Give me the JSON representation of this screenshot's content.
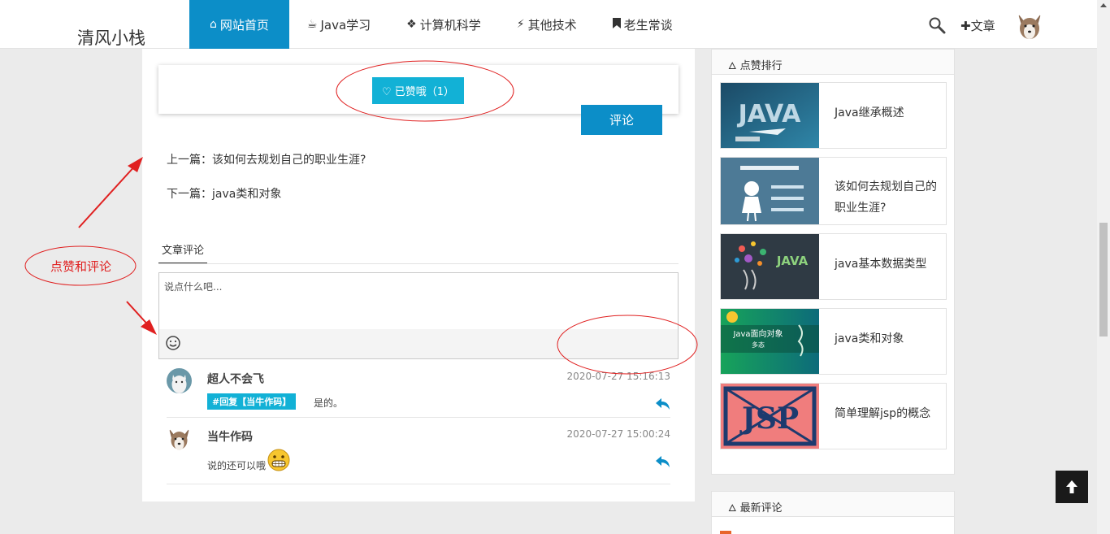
{
  "header": {
    "brand": "清风小栈",
    "nav": [
      {
        "icon": "home-icon",
        "glyph": "⌂",
        "label": "网站首页",
        "active": true
      },
      {
        "icon": "coffee-icon",
        "glyph": "☕",
        "label": "Java学习"
      },
      {
        "icon": "cubes-icon",
        "glyph": "❖",
        "label": "计算机科学"
      },
      {
        "icon": "bolt-icon",
        "glyph": "⚡",
        "label": "其他技术"
      },
      {
        "icon": "bookmark-icon",
        "glyph": "🔖",
        "label": "老生常谈"
      }
    ],
    "write_label": "✚文章"
  },
  "article": {
    "like_label": "♡ 已赞哦（1）",
    "prev": "上一篇：该如何去规划自己的职业生涯?",
    "next": "下一篇：java类和对象"
  },
  "comments": {
    "tab": "文章评论",
    "placeholder": "说点什么吧...",
    "submit": "评论",
    "items": [
      {
        "name": "超人不会飞",
        "time": "2020-07-27 15:16:13",
        "reply_to": "#回复【当牛作码】",
        "text": "是的。"
      },
      {
        "name": "当牛作码",
        "time": "2020-07-27 15:00:24",
        "text": "说的还可以哦"
      }
    ]
  },
  "sidebar": {
    "ranking_title": "点赞排行",
    "ranking": [
      {
        "title_lines": [
          "Java继承概述"
        ]
      },
      {
        "title_lines": [
          "该如何去规划自己的",
          "职业生涯?"
        ]
      },
      {
        "title_lines": [
          "java基本数据类型"
        ]
      },
      {
        "title_lines": [
          "java类和对象"
        ]
      },
      {
        "title_lines": [
          "简单理解jsp的概念"
        ]
      }
    ],
    "latest_title": "最新评论"
  },
  "annotation": {
    "label": "点赞和评论",
    "color": "#e02020"
  },
  "colors": {
    "accent": "#0c8ec8",
    "like": "#12b1d6"
  }
}
